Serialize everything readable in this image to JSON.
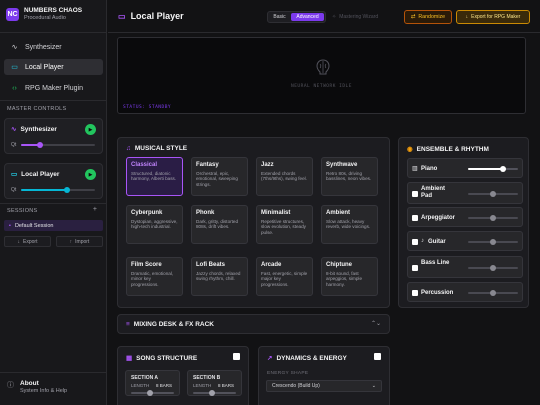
{
  "brand": {
    "title": "NUMBERS CHAOS",
    "subtitle": "Procedural Audio",
    "logo": "NC"
  },
  "nav": [
    {
      "label": "Synthesizer",
      "icon": "waveform-icon",
      "active": false
    },
    {
      "label": "Local Player",
      "icon": "gamepad-icon",
      "active": true
    },
    {
      "label": "RPG Maker Plugin",
      "icon": "code-icon",
      "active": false
    }
  ],
  "master": {
    "label": "MASTER CONTROLS",
    "players": [
      {
        "name": "Synthesizer",
        "q_label": "Qt",
        "level": 0.25,
        "color": "#a855f7"
      },
      {
        "name": "Local Player",
        "q_label": "Qt",
        "level": 0.6,
        "color": "#06b6d4"
      }
    ]
  },
  "sessions": {
    "label": "SESSIONS",
    "add": "+",
    "items": [
      "Default Session"
    ],
    "export_label": "Export",
    "import_label": "Import"
  },
  "about": {
    "title": "About",
    "subtitle": "System Info & Help"
  },
  "header": {
    "title": "Local Player",
    "mode_basic": "Basic",
    "mode_advanced": "Advanced",
    "wizard": "Mastering Wizard",
    "randomize": "Randomize",
    "export": "Export for RPG Maker"
  },
  "visualizer": {
    "idle_text": "NEURAL NETWORK IDLE",
    "status": "STATUS: STANDBY"
  },
  "musical_style": {
    "title": "MUSICAL STYLE",
    "styles": [
      {
        "name": "Classical",
        "desc": "Structured, diatonic harmony, Alberti bass."
      },
      {
        "name": "Fantasy",
        "desc": "Orchestral, epic, emotional, sweeping strings."
      },
      {
        "name": "Jazz",
        "desc": "Extended chords (7ths/9ths), swing feel."
      },
      {
        "name": "Synthwave",
        "desc": "Retro 80s, driving basslines, neon vibes."
      },
      {
        "name": "Cyberpunk",
        "desc": "Dystopian, aggressive, high-tech industrial."
      },
      {
        "name": "Phonk",
        "desc": "Dark, gritty, distorted 808s, drift vibes."
      },
      {
        "name": "Minimalist",
        "desc": "Repetitive structures, slow evolution, steady pulse."
      },
      {
        "name": "Ambient",
        "desc": "Slow attack, heavy reverb, wide voicings."
      },
      {
        "name": "Film Score",
        "desc": "Dramatic, emotional, minor key progressions."
      },
      {
        "name": "Lofi Beats",
        "desc": "Jazzy chords, relaxed swing rhythm, chill."
      },
      {
        "name": "Arcade",
        "desc": "Fast, energetic, simple major key progressions."
      },
      {
        "name": "Chiptune",
        "desc": "8-bit sound, fast arpeggios, simple harmony."
      }
    ],
    "selected": "Classical"
  },
  "ensemble": {
    "title": "ENSEMBLE & RHYTHM",
    "rows": [
      {
        "label": "Piano",
        "icon": "piano-icon",
        "checked": false,
        "has_icon": true,
        "level": 0.7,
        "enabled": true
      },
      {
        "label": "Ambient Pad",
        "checked": false,
        "has_icon": false,
        "level": 0.5,
        "enabled": false
      },
      {
        "label": "Arpeggiator",
        "checked": false,
        "has_icon": false,
        "level": 0.5,
        "enabled": false
      },
      {
        "label": "Guitar",
        "icon": "guitar-icon",
        "checked": false,
        "has_icon": true,
        "level": 0.5,
        "enabled": false
      },
      {
        "label": "Bass Line",
        "checked": false,
        "has_icon": false,
        "level": 0.5,
        "enabled": false
      },
      {
        "label": "Percussion",
        "checked": false,
        "has_icon": false,
        "level": 0.5,
        "enabled": false
      }
    ]
  },
  "mixing": {
    "title": "MIXING DESK & FX RACK"
  },
  "song_structure": {
    "title": "SONG STRUCTURE",
    "sections": [
      {
        "name": "SECTION A",
        "length_label": "LENGTH",
        "bars": "8 BARS"
      },
      {
        "name": "SECTION B",
        "length_label": "LENGTH",
        "bars": "8 BARS"
      }
    ]
  },
  "dynamics": {
    "title": "DYNAMICS & ENERGY",
    "shape_label": "ENERGY SHAPE",
    "shape_value": "Crescendo (Build Up)"
  }
}
